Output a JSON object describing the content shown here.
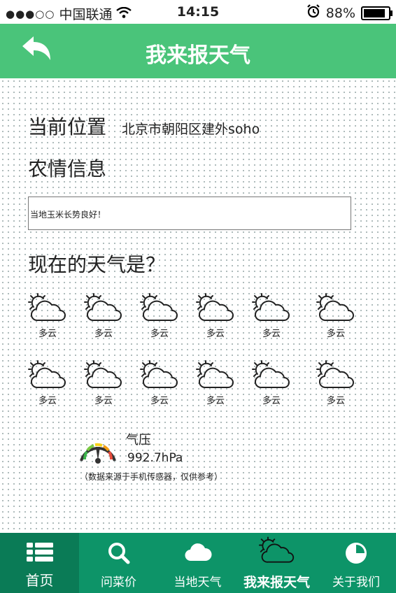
{
  "status_bar": {
    "signal": "●●●○○",
    "carrier": "中国联通",
    "time": "14:15",
    "battery": "88%",
    "battery_level": 0.88
  },
  "header": {
    "back_icon": "back-arrow-icon",
    "title": "我来报天气"
  },
  "location": {
    "label": "当前位置",
    "value": "北京市朝阳区建外soho"
  },
  "farm_info": {
    "label": "农情信息",
    "value": "当地玉米长势良好！"
  },
  "weather_question": "现在的天气是？",
  "weather_options": [
    {
      "icon": "partly-cloudy-icon",
      "label": "多云"
    },
    {
      "icon": "partly-cloudy-icon",
      "label": "多云"
    },
    {
      "icon": "partly-cloudy-icon",
      "label": "多云"
    },
    {
      "icon": "partly-cloudy-icon",
      "label": "多云"
    },
    {
      "icon": "partly-cloudy-icon",
      "label": "多云"
    },
    {
      "icon": "partly-cloudy-icon",
      "label": "多云"
    },
    {
      "icon": "partly-cloudy-icon",
      "label": "多云"
    },
    {
      "icon": "partly-cloudy-icon",
      "label": "多云"
    },
    {
      "icon": "partly-cloudy-icon",
      "label": "多云"
    },
    {
      "icon": "partly-cloudy-icon",
      "label": "多云"
    },
    {
      "icon": "partly-cloudy-icon",
      "label": "多云"
    },
    {
      "icon": "partly-cloudy-icon",
      "label": "多云"
    }
  ],
  "pressure": {
    "icon": "gauge-icon",
    "label": "气压",
    "value": "992.7hPa",
    "note": "（数据来源于手机传感器，仅供参考）"
  },
  "tabs": [
    {
      "icon": "list-icon",
      "label": "首页"
    },
    {
      "icon": "search-icon",
      "label": "问菜价"
    },
    {
      "icon": "cloud-icon",
      "label": "当地天气"
    },
    {
      "icon": "partly-cloudy-icon",
      "label": "我来报天气"
    },
    {
      "icon": "pie-chart-icon",
      "label": "关于我们"
    }
  ],
  "colors": {
    "header": "#4ac47a",
    "tabbar": "#0d9468",
    "tab_home": "#0a7b56"
  }
}
